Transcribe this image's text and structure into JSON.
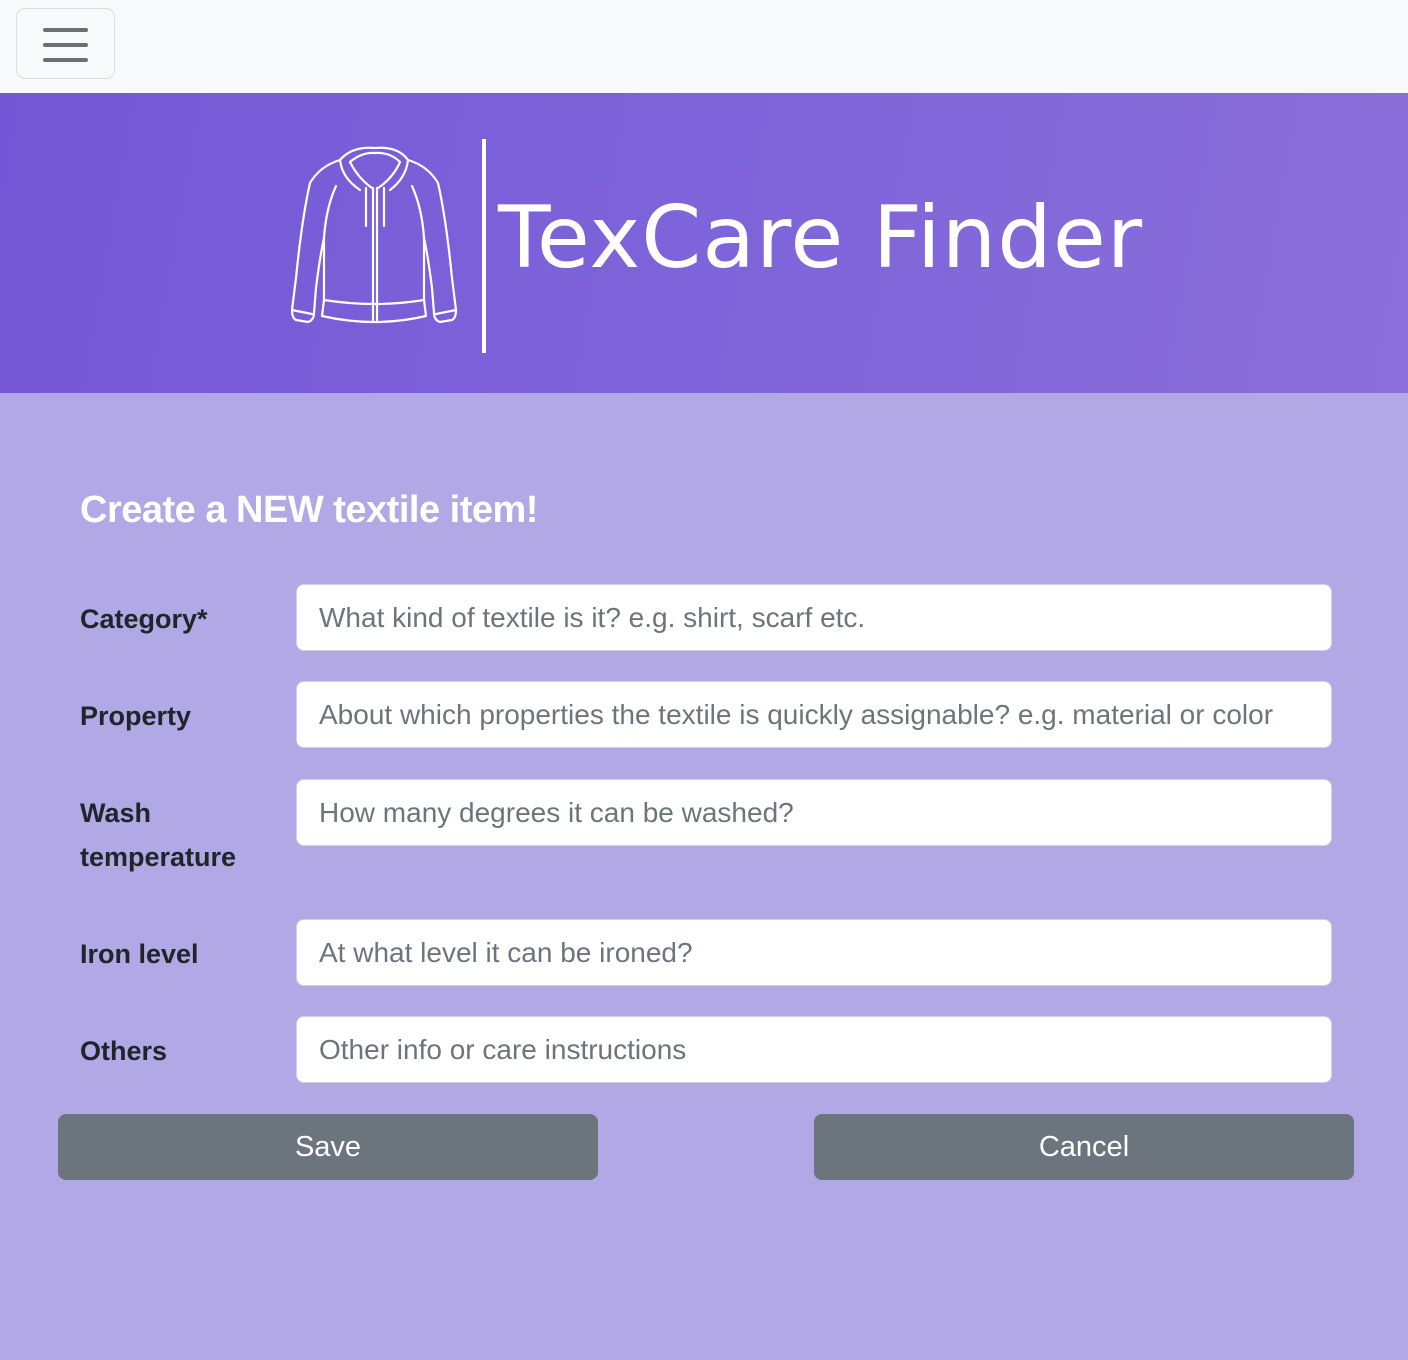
{
  "navbar": {
    "menu_icon": "hamburger-menu-icon"
  },
  "banner": {
    "logo_icon": "hoodie-jacket-icon",
    "app_name": "TexCare Finder",
    "colors": {
      "banner": "#7a5fd8",
      "page_background": "#b3a8e6"
    }
  },
  "form": {
    "title": "Create a NEW textile item!",
    "fields": [
      {
        "label": "Category*",
        "placeholder": "What kind of textile is it? e.g. shirt, scarf etc.",
        "value": ""
      },
      {
        "label": "Property",
        "placeholder": "About which properties the textile is quickly assignable? e.g. material or color",
        "value": ""
      },
      {
        "label": "Wash temperature",
        "placeholder": "How many degrees it can be washed?",
        "value": ""
      },
      {
        "label": "Iron level",
        "placeholder": "At what level it can be ironed?",
        "value": ""
      },
      {
        "label": "Others",
        "placeholder": "Other info or care instructions",
        "value": ""
      }
    ],
    "save_label": "Save",
    "cancel_label": "Cancel",
    "button_color": "#6c757d"
  }
}
